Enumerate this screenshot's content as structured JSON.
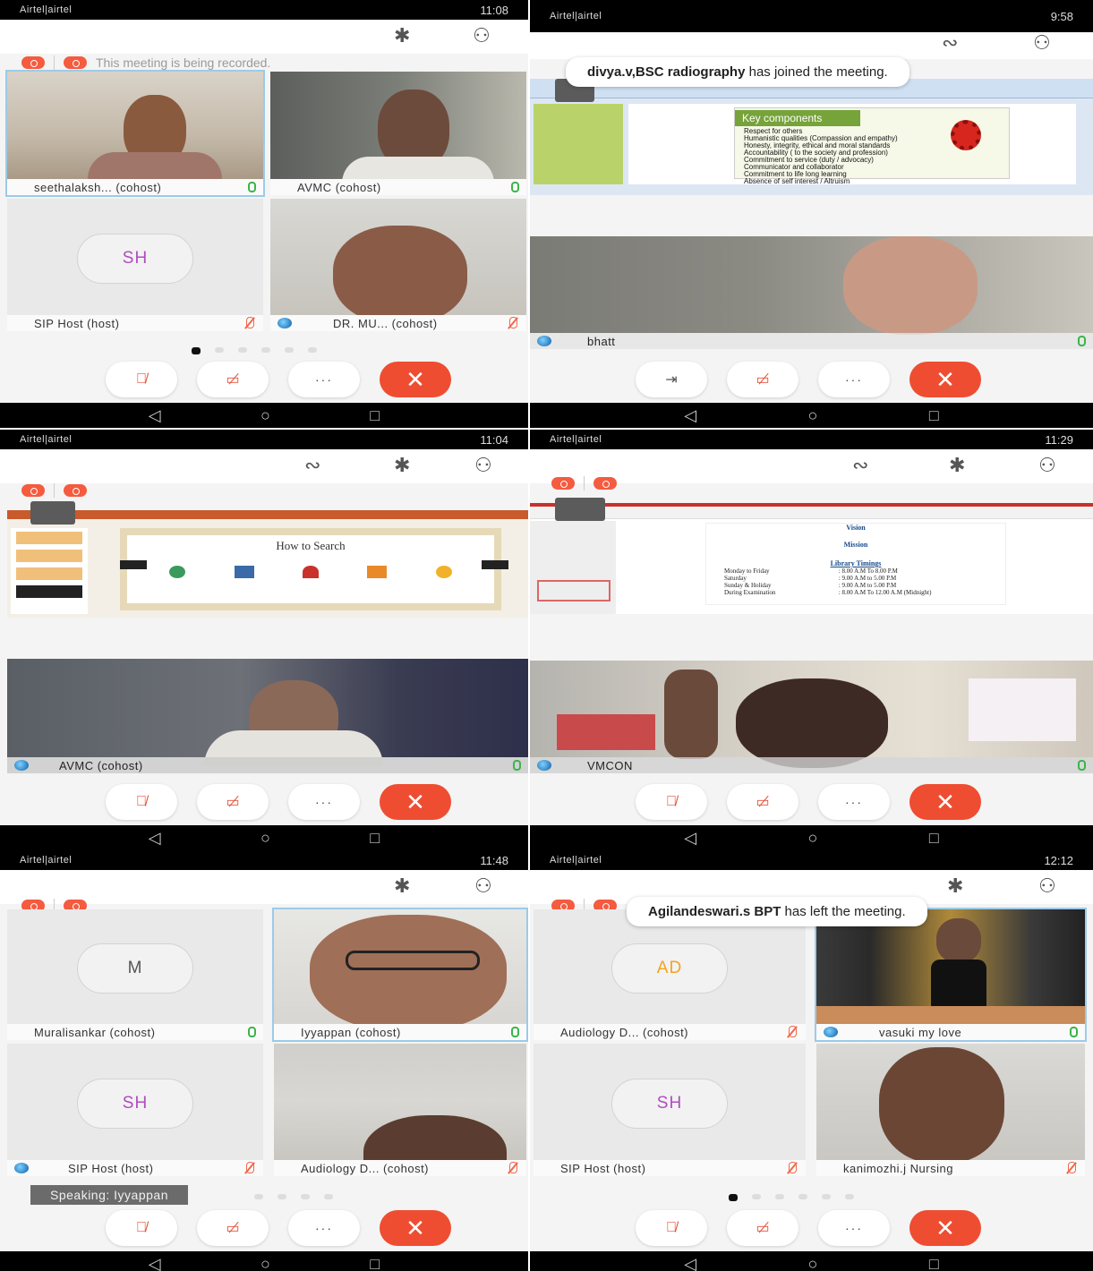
{
  "panel1": {
    "status_left": "Airtel|airtel",
    "status_right": "11:08",
    "recording_text": "This meeting is being recorded.",
    "tiles": [
      {
        "label": "seethalaksh... (cohost)"
      },
      {
        "label": "AVMC (cohost)"
      },
      {
        "label": "SIP Host (host)",
        "initials": "SH"
      },
      {
        "label": "DR. MU... (cohost)"
      }
    ]
  },
  "panel2": {
    "status_left": "Airtel|airtel",
    "status_right": "9:58",
    "toast_bold": "divya.v,BSC radiography",
    "toast_rest": " has joined the meeting.",
    "slide": {
      "heading": "Key components",
      "bullets": [
        "Respect for others",
        "Humanistic qualities (Compassion and empathy)",
        "Honesty, integrity, ethical and moral standards",
        "Accountability ( to the society and profession)",
        "Commitment to service (duty / advocacy)",
        "Communicator and collaborator",
        "Commitment to life long learning",
        "Absence of self interest / Altruism"
      ]
    },
    "video_label": "bhatt"
  },
  "panel3": {
    "status_left": "Airtel|airtel",
    "status_right": "11:04",
    "slide_title": "How to Search",
    "video_label": "AVMC (cohost)"
  },
  "panel4": {
    "status_left": "Airtel|airtel",
    "status_right": "11:29",
    "slide": {
      "heading": "Vision",
      "mission": "Mission",
      "timings_title": "Library Timings",
      "rows": [
        [
          "Monday to Friday",
          ": 8.00 A.M To 8.00 P.M"
        ],
        [
          "Saturday",
          ": 9.00 A.M to 5.00 P.M"
        ],
        [
          "Sunday & Holiday",
          ": 9.00 A.M to 5.00 P.M"
        ],
        [
          "During Examination",
          ": 8.00 A.M To 12.00 A.M (Midnight)"
        ]
      ]
    },
    "video_label": "VMCON"
  },
  "panel5": {
    "status_left": "Airtel|airtel",
    "status_right": "11:48",
    "tiles": [
      {
        "label": "Muralisankar (cohost)",
        "initials": "M"
      },
      {
        "label": "Iyyappan (cohost)"
      },
      {
        "label": "SIP Host (host)",
        "initials": "SH"
      },
      {
        "label": "Audiology D... (cohost)"
      }
    ],
    "speaking": "Speaking: Iyyappan"
  },
  "panel6": {
    "status_left": "Airtel|airtel",
    "status_right": "12:12",
    "toast_bold": "Agilandeswari.s BPT",
    "toast_rest": " has left the meeting.",
    "tiles": [
      {
        "label": "Audiology D... (cohost)",
        "initials": "AD"
      },
      {
        "label": "vasuki my love"
      },
      {
        "label": "SIP Host (host)",
        "initials": "SH"
      },
      {
        "label": "kanimozhi.j Nursing"
      }
    ]
  },
  "controls": {
    "more": "···",
    "end": "✕"
  },
  "colors": {
    "end_red": "#ef4d32",
    "avatar_purple": "#b04cc0",
    "avatar_orange": "#f4a21c",
    "mic_on": "#3bb54a",
    "mic_off": "#f2674c"
  }
}
